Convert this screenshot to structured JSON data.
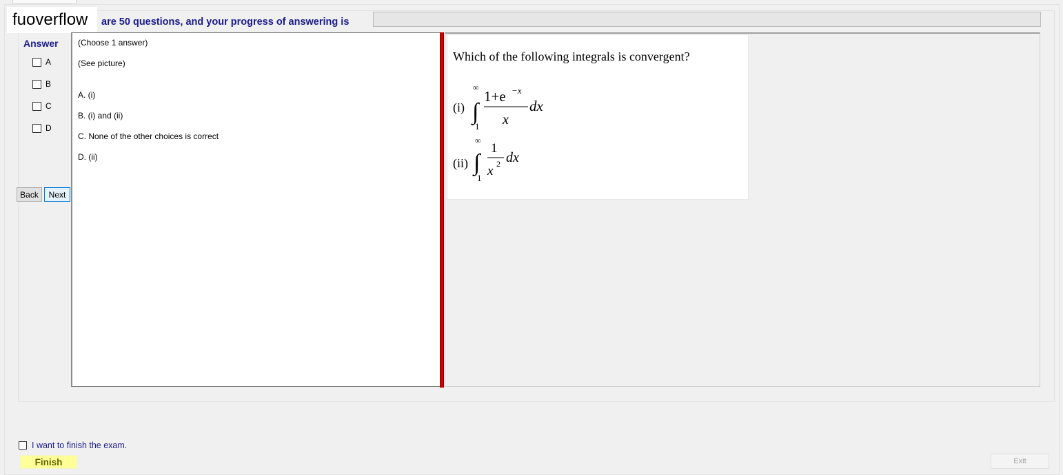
{
  "header": {
    "logo_text": "fuoverflow",
    "progress_text": "are 50 questions, and your progress of answering is",
    "progress_fraction": 0.0
  },
  "answer_panel": {
    "title": "Answer",
    "options": [
      {
        "label": "A",
        "checked": false
      },
      {
        "label": "B",
        "checked": false
      },
      {
        "label": "C",
        "checked": false
      },
      {
        "label": "D",
        "checked": false
      }
    ],
    "back_label": "Back",
    "next_label": "Next"
  },
  "question": {
    "instruction": "(Choose 1 answer)",
    "note": "(See picture)",
    "choices": [
      "A. (i)",
      "B. (i) and (ii)",
      "C. None of the other choices is correct",
      "D. (ii)"
    ]
  },
  "picture": {
    "question_text": "Which of the following integrals is convergent?",
    "item_i_label": "(i)",
    "item_ii_label": "(ii)",
    "upper_limit": "∞",
    "lower_limit": "1",
    "i_numerator": "1+e",
    "i_exponent": "−x",
    "i_denominator": "x",
    "ii_numerator": "1",
    "ii_denominator": "x",
    "ii_power": "2",
    "differential": "dx",
    "integral_sign": "∫"
  },
  "footer": {
    "finish_checkbox_label": "I want to finish the exam.",
    "finish_checked": false,
    "finish_label": "Finish",
    "exit_label": "Exit"
  },
  "colors": {
    "accent_text": "#1a1a8c",
    "divider": "#d40000",
    "finish_bg": "#ffff99"
  }
}
